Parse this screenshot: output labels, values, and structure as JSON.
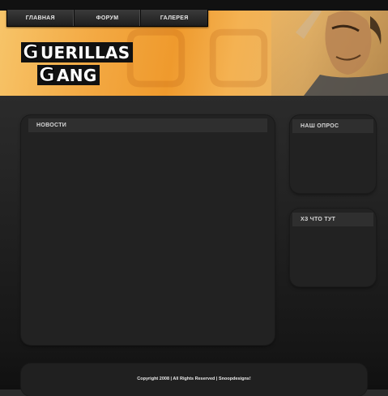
{
  "nav": {
    "items": [
      "ГЛАВНАЯ",
      "ФОРУМ",
      "ГАЛЕРЕЯ"
    ]
  },
  "logo": {
    "line1_first": "G",
    "line1_rest": "UERILLAS",
    "line2_first": "G",
    "line2_rest": "ANG"
  },
  "panels": {
    "news_title": "НОВОСТИ",
    "poll_title": "НАШ ОПРОС",
    "misc_title": "ХЗ ЧТО ТУТ"
  },
  "footer": {
    "text": "Copyright 2008 | All Rights Reserved | Snoopdesigns!"
  },
  "colors": {
    "header_orange": "#ef9a2d",
    "background": "#1c1c1c",
    "panel": "#222222"
  }
}
